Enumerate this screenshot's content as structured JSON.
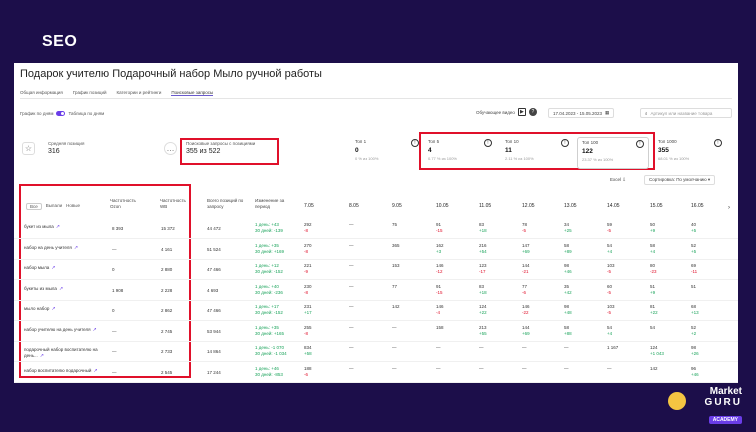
{
  "slide": {
    "title": "SEO"
  },
  "page": {
    "title": "Подарок учителю Подарочный набор Мыло ручной работы"
  },
  "tabs": [
    "Общая информация",
    "График позиций",
    "Категории и рейтинги",
    "Поисковые запросы"
  ],
  "toggle": {
    "left": "График по дням",
    "right": "Таблица по дням"
  },
  "controls": {
    "hourly": "Обучающее видео",
    "date_range": "17.04.2023 - 15.05.2023",
    "search_placeholder": "Артикул или название товара"
  },
  "stats": {
    "avg_pos_label": "Средняя позиция",
    "avg_pos_value": "316",
    "queries_label": "Поисковые запросы с позициями",
    "queries_value": "355 из 522"
  },
  "top_cards": [
    {
      "label": "Топ 1",
      "num": "0",
      "sub": "0 % из 100%"
    },
    {
      "label": "Топ 5",
      "num": "4",
      "sub": "0.77 % из 100%"
    },
    {
      "label": "Топ 10",
      "num": "11",
      "sub": "2.11 % из 100%"
    },
    {
      "label": "Топ 100",
      "num": "122",
      "sub": "23.37 % из 100%"
    },
    {
      "label": "Топ 1000",
      "num": "355",
      "sub": "68.01 % из 100%"
    }
  ],
  "export": "Excel",
  "sort": "Сортировка: По умолчанию",
  "segments": [
    "Все",
    "Выпали",
    "Новые"
  ],
  "headers": {
    "freq_ozon": "Частотность Ozon",
    "freq_wb": "Частотность WB",
    "total_pos": "Всего позиций по запросу",
    "change": "Изменение за период"
  },
  "dates": [
    "7.05",
    "8.05",
    "9.05",
    "10.05",
    "11.05",
    "12.05",
    "13.05",
    "14.05",
    "15.05",
    "16.05"
  ],
  "rows": [
    {
      "kw": "букет из мыла",
      "ozon": "8 393",
      "wb": "15 372",
      "total": "44 472",
      "ch1": "1 день: +43",
      "ch2": "30 дней: -139",
      "c0": "292",
      "c0s": "-8",
      "c1": "—",
      "c2": "75",
      "c3": "91",
      "c3s": "-15",
      "c4": "83",
      "c4s": "+18",
      "c5": "78",
      "c5s": "-5",
      "c6": "34",
      "c6s": "+25",
      "c7": "59",
      "c7s": "-5",
      "c8": "50",
      "c8s": "+9",
      "c9": "40",
      "c9s": "+5"
    },
    {
      "kw": "набор на день учителя",
      "ozon": "—",
      "wb": "4 161",
      "total": "51 524",
      "ch1": "1 день: +35",
      "ch2": "30 дней: +169",
      "c0": "270",
      "c0s": "-8",
      "c1": "—",
      "c2": "365",
      "c3": "162",
      "c3s": "+3",
      "c4": "216",
      "c4s": "+54",
      "c5": "147",
      "c5s": "+69",
      "c6": "58",
      "c6s": "+89",
      "c7": "54",
      "c7s": "+4",
      "c8": "58",
      "c8s": "+4",
      "c9": "52",
      "c9s": "+5"
    },
    {
      "kw": "набор мыла",
      "ozon": "0",
      "wb": "2 880",
      "total": "47 466",
      "ch1": "1 день: +12",
      "ch2": "30 дней: -152",
      "c0": "221",
      "c0s": "-9",
      "c1": "—",
      "c2": "153",
      "c3": "146",
      "c3s": "-12",
      "c4": "123",
      "c4s": "-17",
      "c5": "144",
      "c5s": "-21",
      "c6": "98",
      "c6s": "+46",
      "c7": "103",
      "c7s": "-5",
      "c8": "80",
      "c8s": "-23",
      "c9": "69",
      "c9s": "-11"
    },
    {
      "kw": "букеты из мыла",
      "ozon": "1 908",
      "wb": "2 228",
      "total": "4 693",
      "ch1": "1 день: +40",
      "ch2": "30 дней: -236",
      "c0": "230",
      "c0s": "-8",
      "c1": "—",
      "c2": "77",
      "c3": "91",
      "c3s": "-15",
      "c4": "83",
      "c4s": "+18",
      "c5": "77",
      "c5s": "-6",
      "c6": "35",
      "c6s": "+42",
      "c7": "60",
      "c7s": "-5",
      "c8": "51",
      "c8s": "+9",
      "c9": "51",
      "c9s": ""
    },
    {
      "kw": "мыло набор",
      "ozon": "0",
      "wb": "2 862",
      "total": "47 466",
      "ch1": "1 день: +17",
      "ch2": "30 дней: -152",
      "c0": "231",
      "c0s": "+17",
      "c1": "—",
      "c2": "142",
      "c3": "146",
      "c3s": "-4",
      "c4": "124",
      "c4s": "+22",
      "c5": "146",
      "c5s": "-22",
      "c6": "98",
      "c6s": "+48",
      "c7": "103",
      "c7s": "-5",
      "c8": "81",
      "c8s": "+22",
      "c9": "68",
      "c9s": "+13"
    },
    {
      "kw": "набор учителю на день учителя",
      "ozon": "—",
      "wb": "2 745",
      "total": "53 944",
      "ch1": "1 день: +35",
      "ch2": "30 дней: +165",
      "c0": "255",
      "c0s": "-8",
      "c1": "—",
      "c2": "—",
      "c3": "158",
      "c3s": "",
      "c4": "213",
      "c4s": "+55",
      "c5": "144",
      "c5s": "+69",
      "c6": "58",
      "c6s": "+88",
      "c7": "54",
      "c7s": "+4",
      "c8": "54",
      "c8s": "",
      "c9": "52",
      "c9s": "+2"
    },
    {
      "kw": "подарочный набор воспитателю на день...",
      "ozon": "—",
      "wb": "2 733",
      "total": "14 864",
      "ch1": "1 день: -1 070",
      "ch2": "30 дней: -1 034",
      "c0": "834",
      "c0s": "+58",
      "c1": "—",
      "c2": "—",
      "c3": "—",
      "c3s": "",
      "c4": "—",
      "c4s": "",
      "c5": "—",
      "c5s": "",
      "c6": "—",
      "c6s": "",
      "c7": "1 167",
      "c7s": "",
      "c8": "124",
      "c8s": "+1 043",
      "c9": "98",
      "c9s": "+26"
    },
    {
      "kw": "набор воспитателю подарочный",
      "ozon": "—",
      "wb": "2 545",
      "total": "17 244",
      "ch1": "1 день: +46",
      "ch2": "30 дней: -853",
      "c0": "188",
      "c0s": "-6",
      "c1": "—",
      "c2": "—",
      "c3": "—",
      "c3s": "",
      "c4": "—",
      "c4s": "",
      "c5": "—",
      "c5s": "",
      "c6": "—",
      "c6s": "",
      "c7": "—",
      "c7s": "",
      "c8": "142",
      "c8s": "",
      "c9": "96",
      "c9s": "+46"
    }
  ],
  "logo": {
    "l1": "Market",
    "l2": "GURU",
    "l3": "ACADEMY"
  },
  "colors": {
    "accent": "#6a3de8",
    "highlight": "#e0102a",
    "up": "#19a35a",
    "down": "#e0102a",
    "background": "#1c0e4a"
  }
}
